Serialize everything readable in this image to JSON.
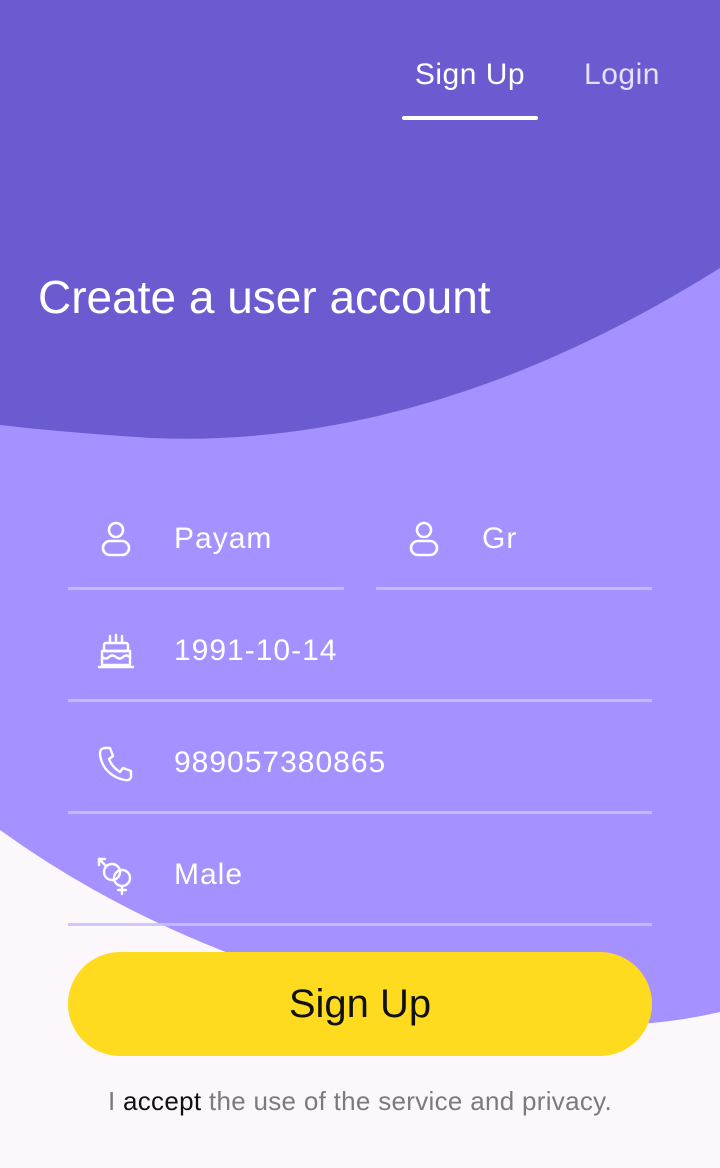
{
  "tabs": {
    "signup_label": "Sign Up",
    "login_label": "Login"
  },
  "page_title": "Create a user account",
  "form": {
    "first_name": "Payam",
    "last_name": "Gr",
    "birth_date": "1991-10-14",
    "phone": "989057380865",
    "gender": "Male"
  },
  "signup_button_label": "Sign Up",
  "terms": {
    "prefix": "I ",
    "accent": "accept",
    "suffix": " the use of the service and privacy."
  },
  "colors": {
    "header_purple": "#6A5BD1",
    "form_purple": "#A591FF",
    "background": "#FCF7FB",
    "button_yellow": "#FFDB1F"
  },
  "icons": {
    "first_name": "user-icon",
    "last_name": "user-icon",
    "birth_date": "cake-icon",
    "phone": "phone-icon",
    "gender": "gender-icon"
  }
}
